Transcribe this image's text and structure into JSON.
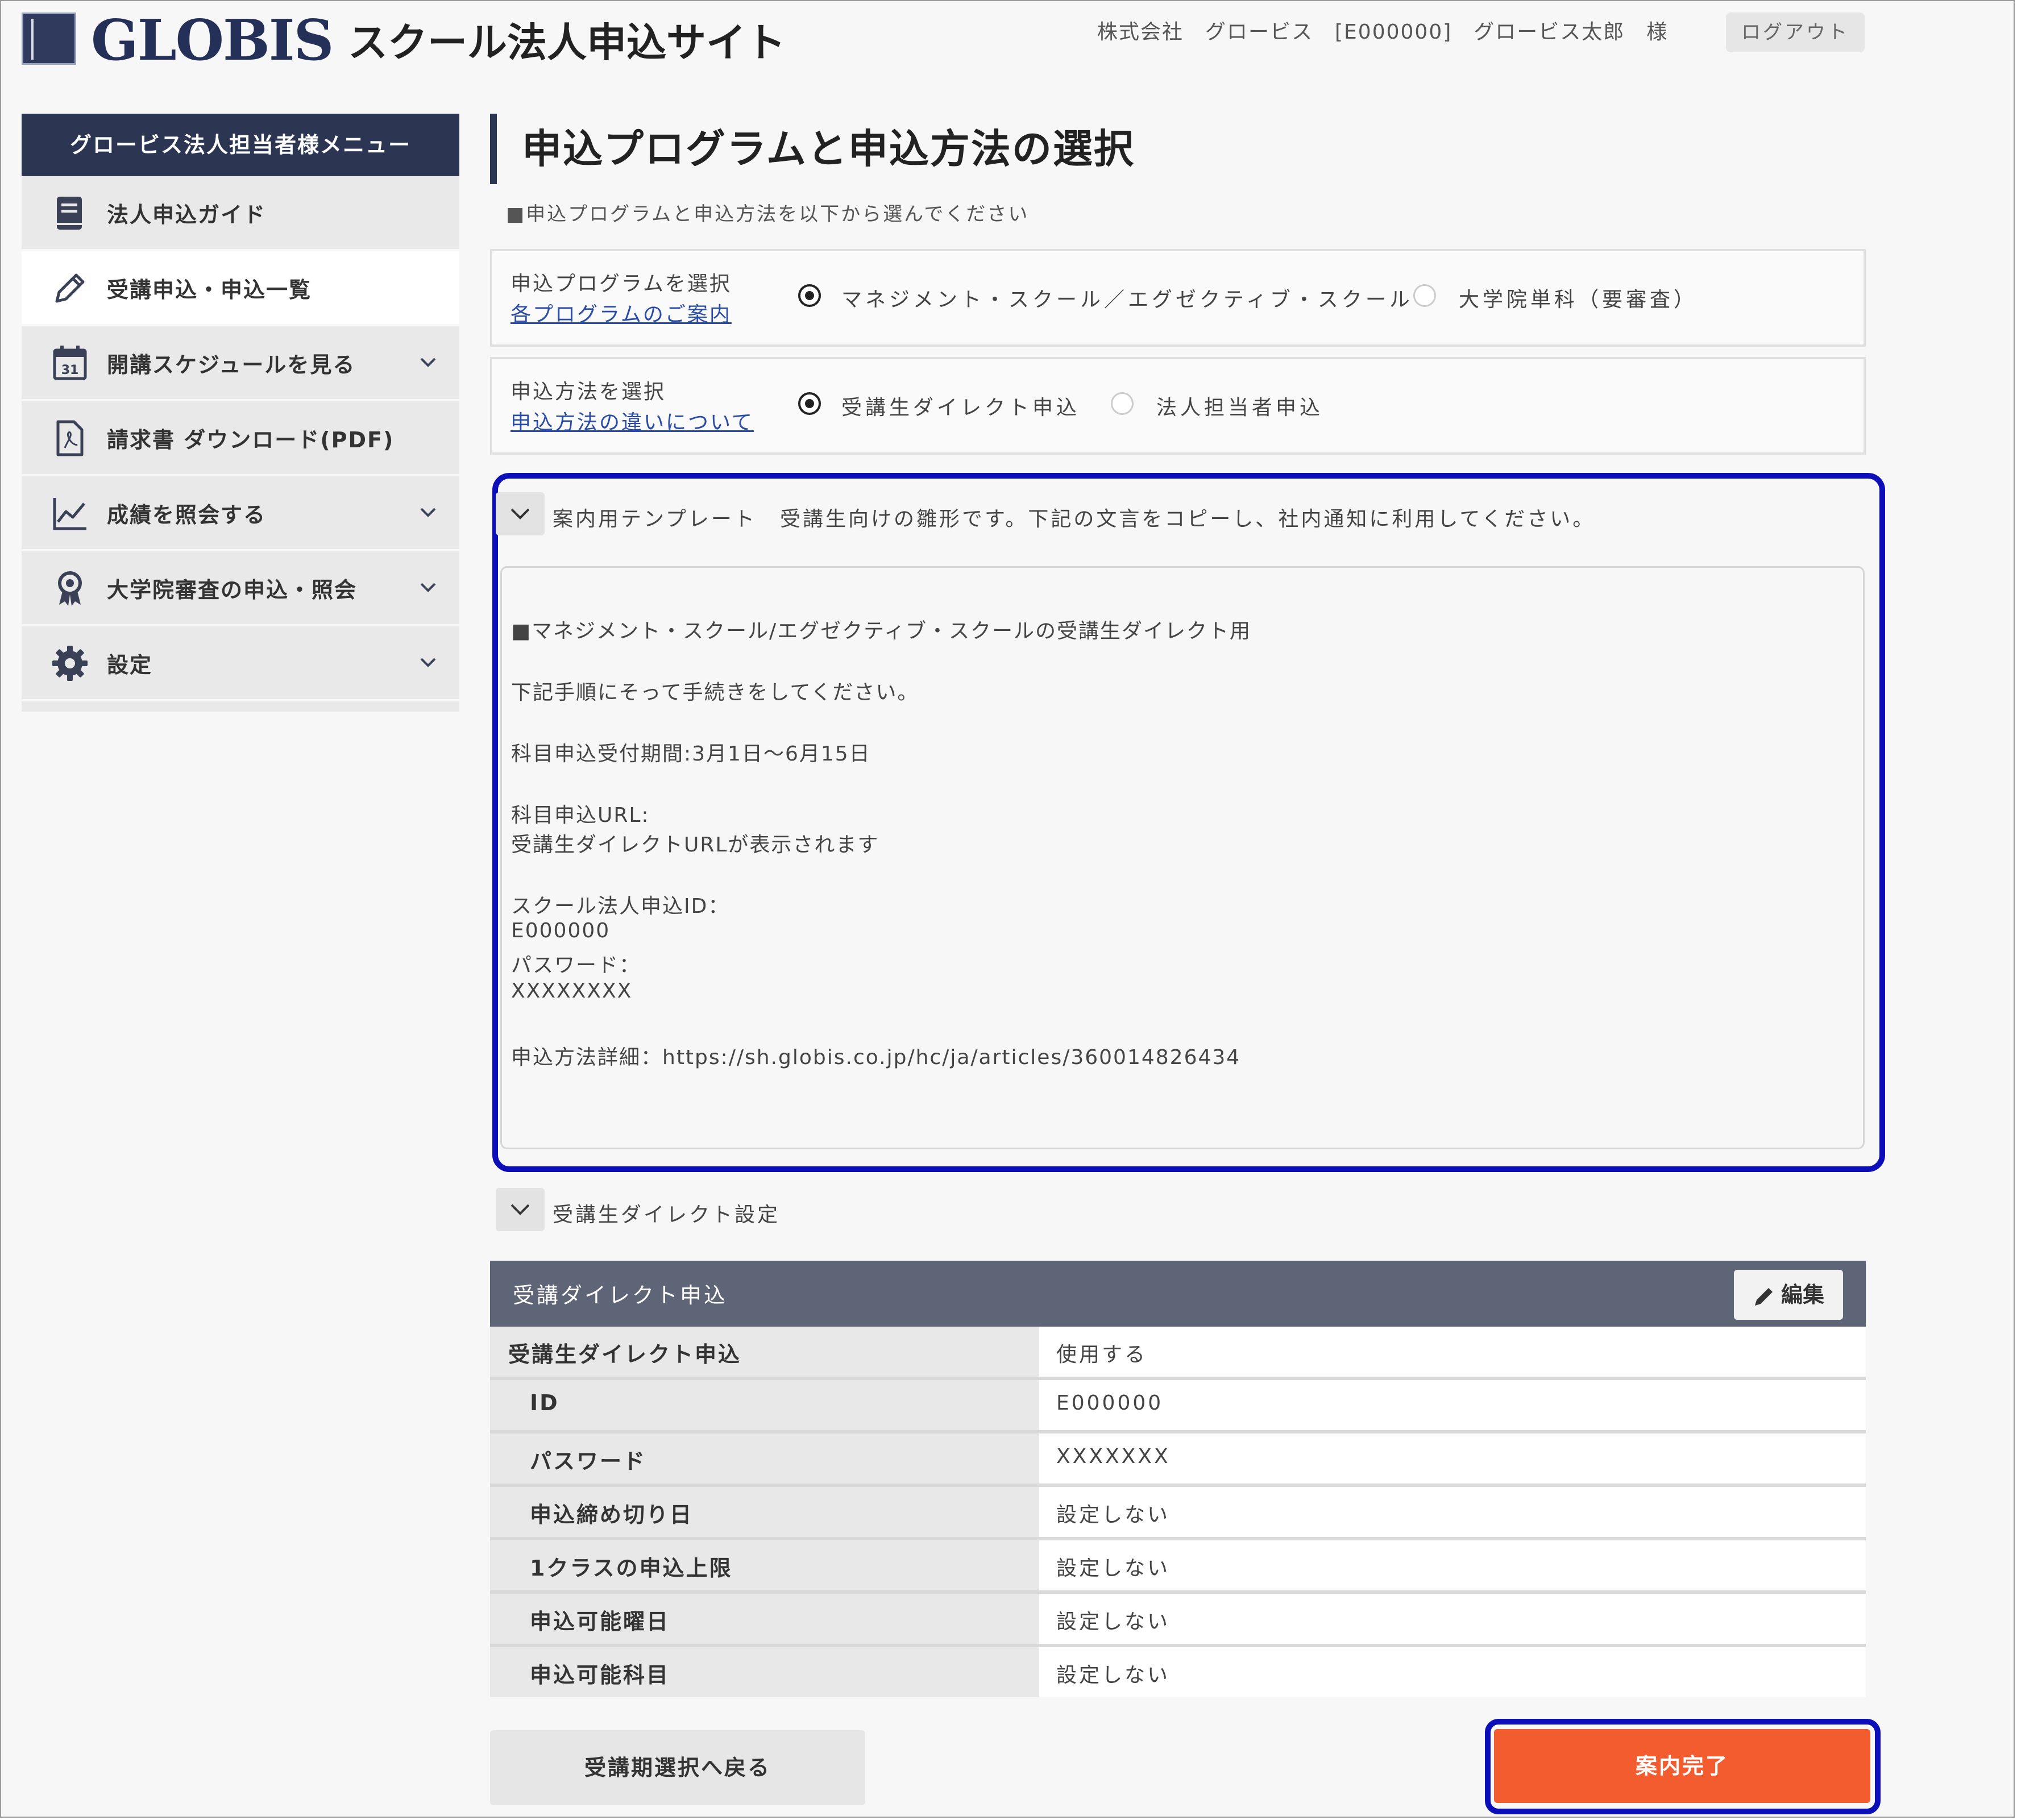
{
  "header": {
    "logo_text": "GLOBIS",
    "site_title": "スクール法人申込サイト",
    "user_info": "株式会社　グロービス　[E000000]　グロービス太郎　様",
    "logout_label": "ログアウト"
  },
  "sidebar": {
    "header": "グロービス法人担当者様メニュー",
    "items": [
      {
        "label": "法人申込ガイド",
        "icon": "book-icon"
      },
      {
        "label": "受講申込・申込一覧",
        "icon": "pencil-icon"
      },
      {
        "label": "開講スケジュールを見る",
        "icon": "calendar-icon"
      },
      {
        "label": "請求書 ダウンロード(PDF)",
        "icon": "pdf-icon"
      },
      {
        "label": "成績を照会する",
        "icon": "chart-line-icon"
      },
      {
        "label": "大学院審査の申込・照会",
        "icon": "award-icon"
      },
      {
        "label": "設定",
        "icon": "gear-icon"
      }
    ]
  },
  "main": {
    "page_title": "申込プログラムと申込方法の選択",
    "instruction": "■申込プログラムと申込方法を以下から選んでください",
    "program_select": {
      "label": "申込プログラムを選択",
      "link": "各プログラムのご案内",
      "options": [
        "マネジメント・スクール／エグゼクティブ・スクール",
        "大学院単科（要審査）"
      ],
      "selected": 0
    },
    "method_select": {
      "label": "申込方法を選択",
      "link": "申込方法の違いについて",
      "options": [
        "受講生ダイレクト申込",
        "法人担当者申込"
      ],
      "selected": 0
    },
    "template": {
      "toggle_label": "案内用テンプレート",
      "toggle_desc": "受講生向けの雛形です。下記の文言をコピーし、社内通知に利用してください。",
      "lines": [
        "■マネジメント・スクール/エグゼクティブ・スクールの受講生ダイレクト用",
        "下記手順にそって手続きをしてください。",
        "科目申込受付期間:3月1日～6月15日",
        "科目申込URL:",
        "受講生ダイレクトURLが表示されます",
        "スクール法人申込ID：",
        "E000000",
        "パスワード：",
        "XXXXXXXX",
        "申込方法詳細：https://sh.globis.co.jp/hc/ja/articles/360014826434"
      ]
    },
    "direct_settings": {
      "toggle_label": "受講生ダイレクト設定",
      "table_title": "受講ダイレクト申込",
      "edit_label": "編集",
      "rows": [
        {
          "key": "受講生ダイレクト申込",
          "value": "使用する"
        },
        {
          "key": "ID",
          "value": "E000000"
        },
        {
          "key": "パスワード",
          "value": "XXXXXXX"
        },
        {
          "key": "申込締め切り日",
          "value": "設定しない"
        },
        {
          "key": "1クラスの申込上限",
          "value": "設定しない"
        },
        {
          "key": "申込可能曜日",
          "value": "設定しない"
        },
        {
          "key": "申込可能科目",
          "value": "設定しない"
        }
      ]
    },
    "footer": {
      "back_label": "受講期選択へ戻る",
      "done_label": "案内完了"
    }
  },
  "colors": {
    "navy": "#2c3653",
    "accent_orange": "#f25c2e",
    "highlight_blue": "#0c0fb8",
    "table_header": "#5e6577"
  }
}
